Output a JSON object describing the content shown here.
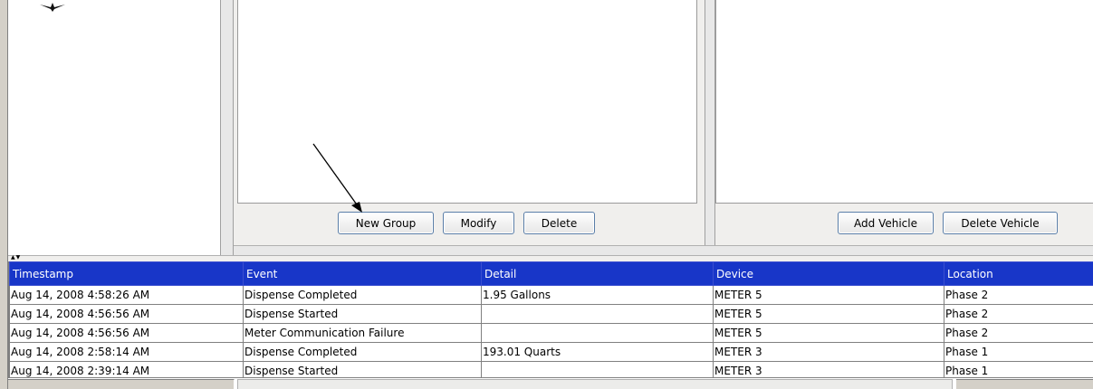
{
  "groups_panel": {
    "buttons": {
      "new_group": "New Group",
      "modify": "Modify",
      "delete": "Delete"
    }
  },
  "vehicles_panel": {
    "buttons": {
      "add_vehicle": "Add Vehicle",
      "delete_vehicle": "Delete Vehicle"
    }
  },
  "event_table": {
    "columns": [
      "Timestamp",
      "Event",
      "Detail",
      "Device",
      "Location"
    ],
    "rows": [
      [
        "Aug 14, 2008 4:58:26 AM",
        "Dispense Completed",
        "1.95 Gallons",
        "METER 5",
        "Phase 2"
      ],
      [
        "Aug 14, 2008 4:56:56 AM",
        "Dispense Started",
        "",
        "METER 5",
        "Phase 2"
      ],
      [
        "Aug 14, 2008 4:56:56 AM",
        "Meter Communication Failure",
        "",
        "METER 5",
        "Phase 2"
      ],
      [
        "Aug 14, 2008 2:58:14 AM",
        "Dispense Completed",
        "193.01 Quarts",
        "METER 3",
        "Phase 1"
      ],
      [
        "Aug 14, 2008 2:39:14 AM",
        "Dispense Started",
        "",
        "METER 3",
        "Phase 1"
      ]
    ],
    "header_color": "#1836c8"
  },
  "status_bar": {
    "left_text": "",
    "right_text": ""
  },
  "icons": {
    "tree_node": "tree-node-icon",
    "splitter_arrows": "splitter-arrows-icon",
    "annotation_arrow": "arrow-annotation"
  }
}
